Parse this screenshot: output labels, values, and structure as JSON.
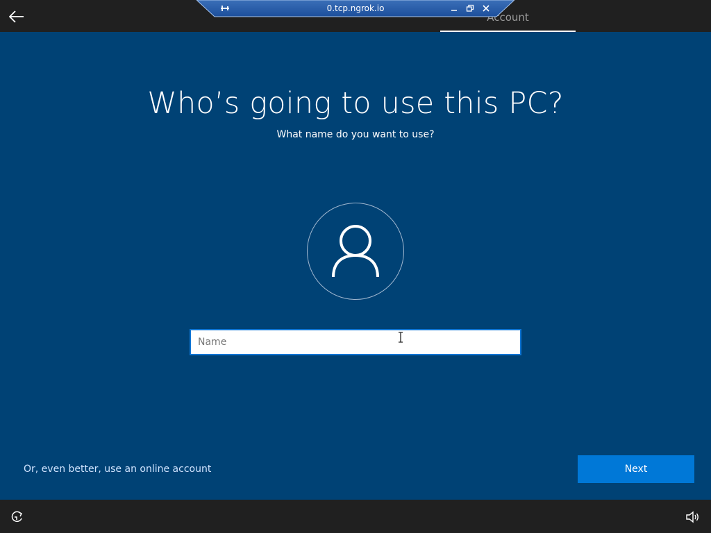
{
  "topbar": {
    "back_icon": "arrow-left-icon",
    "tab_label": "Account"
  },
  "remote_bar": {
    "title": "0.tcp.ngrok.io",
    "pin_icon": "pin-icon",
    "minimize_icon": "minimize-icon",
    "restore_icon": "restore-icon",
    "close_icon": "close-icon"
  },
  "main": {
    "heading": "Who’s going to use this PC?",
    "subheading": "What name do you want to use?",
    "avatar_icon": "user-icon",
    "name_input": {
      "value": "",
      "placeholder": "Name"
    },
    "online_account_link": "Or, even better, use an online account",
    "next_label": "Next"
  },
  "bottombar": {
    "ease_icon": "ease-of-access-icon",
    "volume_icon": "volume-icon"
  },
  "colors": {
    "background": "#004275",
    "bars": "#202020",
    "accent": "#0078d7"
  }
}
